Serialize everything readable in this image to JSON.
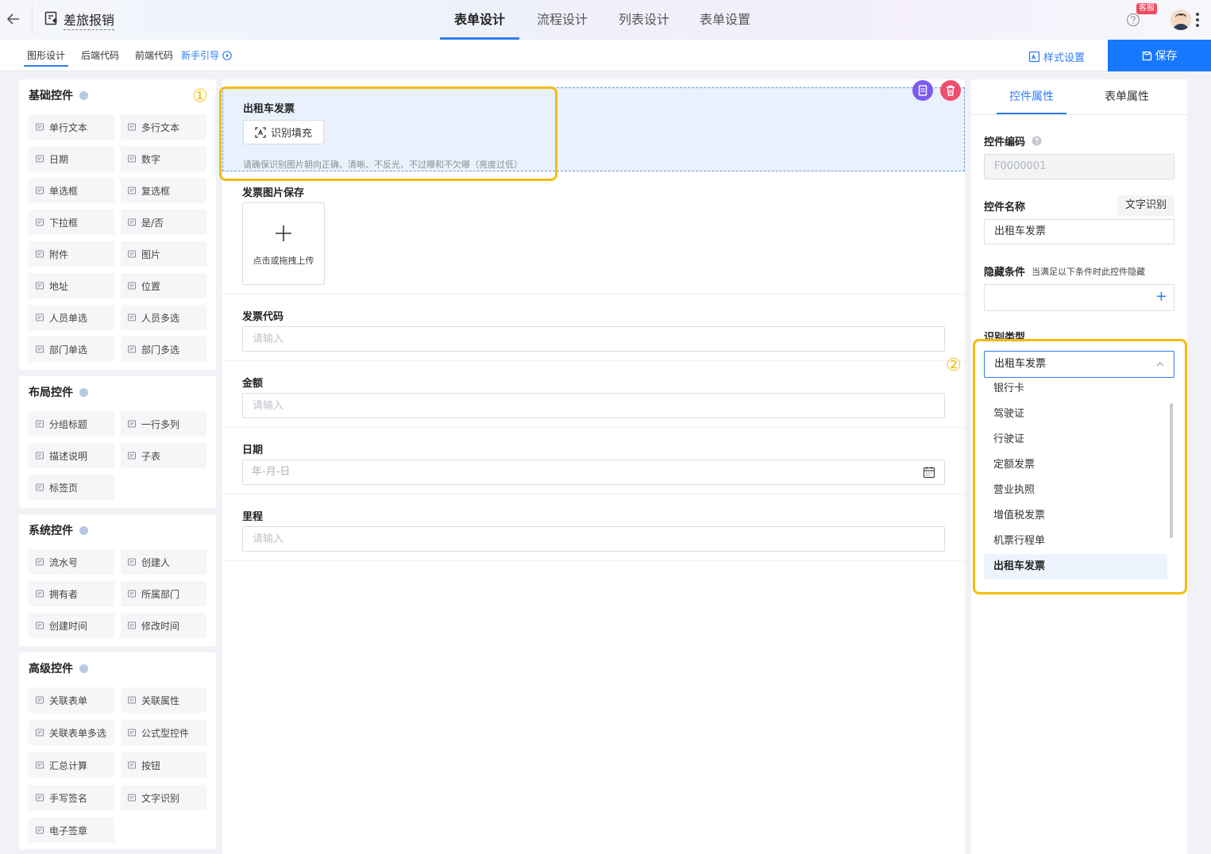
{
  "header": {
    "back_icon": "arrow-left-icon",
    "app_title": "差旅报销",
    "tabs": [
      "表单设计",
      "流程设计",
      "列表设计",
      "表单设置"
    ],
    "active_tab": "表单设计",
    "kefu_badge": "客服",
    "accent": "#2f7cf6"
  },
  "subbar": {
    "tabs": [
      "图形设计",
      "后端代码",
      "前端代码"
    ],
    "guide": "新手引导",
    "style_settings": "样式设置",
    "save": "保存"
  },
  "palette": {
    "groups": [
      {
        "title": "基础控件",
        "items": [
          "单行文本",
          "多行文本",
          "日期",
          "数字",
          "单选框",
          "复选框",
          "下拉框",
          "是/否",
          "附件",
          "图片",
          "地址",
          "位置",
          "人员单选",
          "人员多选",
          "部门单选",
          "部门多选"
        ]
      },
      {
        "title": "布局控件",
        "items": [
          "分组标题",
          "一行多列",
          "描述说明",
          "子表",
          "标签页"
        ]
      },
      {
        "title": "系统控件",
        "items": [
          "流水号",
          "创建人",
          "拥有者",
          "所属部门",
          "创建时间",
          "修改时间"
        ]
      },
      {
        "title": "高级控件",
        "items": [
          "关联表单",
          "关联属性",
          "关联表单多选",
          "公式型控件",
          "汇总计算",
          "按钮",
          "手写签名",
          "文字识别",
          "电子签章"
        ]
      }
    ]
  },
  "canvas": {
    "ocr_field": {
      "label": "出租车发票",
      "button": "识别填充",
      "hint": "请确保识别图片朝向正确、清晰、不反光、不过曝和不欠曝（亮度过低）"
    },
    "image_field": {
      "label": "发票图片保存",
      "upload_text": "点击或拖拽上传"
    },
    "fields": [
      {
        "label": "发票代码",
        "placeholder": "请输入"
      },
      {
        "label": "金额",
        "placeholder": "请输入"
      },
      {
        "label": "日期",
        "placeholder": "年-月-日"
      },
      {
        "label": "里程",
        "placeholder": "请输入"
      }
    ],
    "markers": [
      "①",
      "②"
    ],
    "highlight_color": "#f2bd14"
  },
  "props": {
    "tabs": [
      "控件属性",
      "表单属性"
    ],
    "code_label": "控件编码",
    "code_value": "F0000001",
    "name_label": "控件名称",
    "name_tag": "文字识别",
    "name_value": "出租车发票",
    "hide_label": "隐藏条件",
    "hide_sub": "当满足以下条件时此控件隐藏",
    "type_label": "识别类型",
    "type_value": "出租车发票",
    "options": [
      "银行卡",
      "驾驶证",
      "行驶证",
      "定额发票",
      "营业执照",
      "增值税发票",
      "机票行程单",
      "出租车发票"
    ],
    "selected_option": "出租车发票"
  }
}
